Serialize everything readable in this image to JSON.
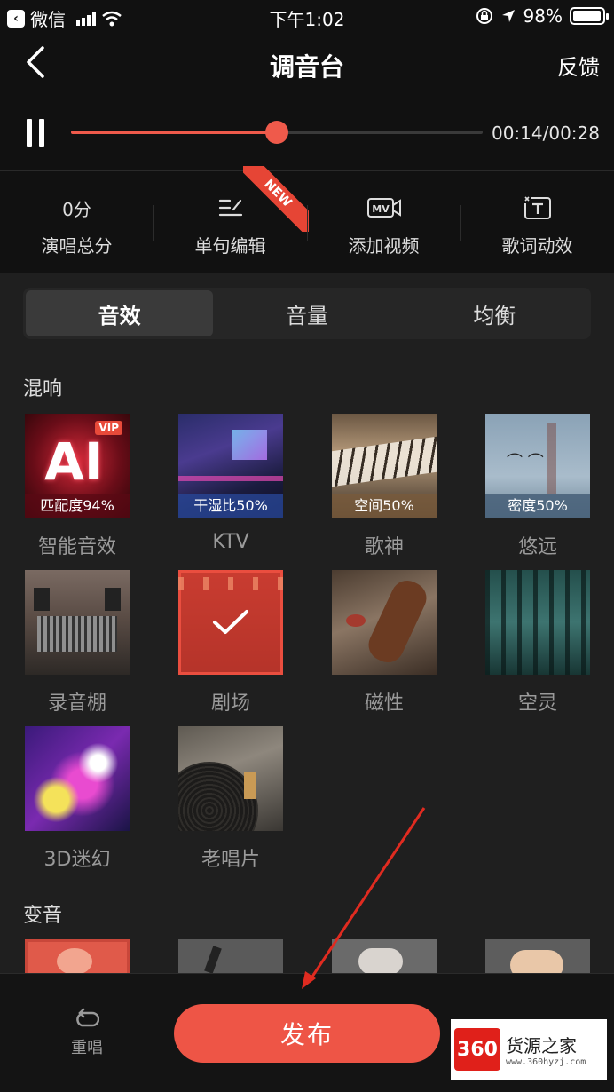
{
  "status_bar": {
    "carrier": "微信",
    "time": "下午1:02",
    "battery": "98%",
    "battery_level": 0.98
  },
  "header": {
    "title": "调音台",
    "feedback": "反馈"
  },
  "player": {
    "time": "00:14/00:28",
    "progress": 0.5
  },
  "tools": [
    {
      "value": "0分",
      "label": "演唱总分"
    },
    {
      "label": "单句编辑",
      "tag": "NEW"
    },
    {
      "label": "添加视频"
    },
    {
      "label": "歌词动效"
    }
  ],
  "tabs": [
    "音效",
    "音量",
    "均衡"
  ],
  "sections": {
    "reverb": "混响",
    "voice_change": "变音"
  },
  "reverb_items": [
    {
      "name": "智能音效",
      "caption": "匹配度94%",
      "badge": "VIP",
      "art_text": "AI"
    },
    {
      "name": "KTV",
      "caption": "干湿比50%"
    },
    {
      "name": "歌神",
      "caption": "空间50%"
    },
    {
      "name": "悠远",
      "caption": "密度50%"
    },
    {
      "name": "录音棚"
    },
    {
      "name": "剧场"
    },
    {
      "name": "磁性"
    },
    {
      "name": "空灵"
    },
    {
      "name": "3D迷幻"
    },
    {
      "name": "老唱片"
    }
  ],
  "bottom": {
    "redo": "重唱",
    "publish": "发布"
  },
  "watermark": {
    "logo": "360",
    "name": "货源之家",
    "url": "www.360hyzj.com"
  },
  "colors": {
    "accent": "#ee5546",
    "background": "#1f1f1f",
    "bar": "#111111"
  }
}
